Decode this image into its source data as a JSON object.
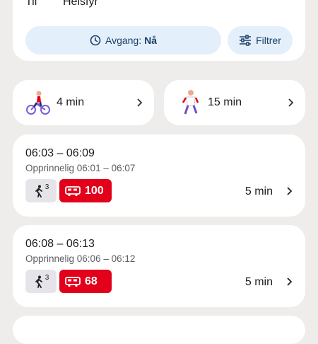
{
  "search": {
    "to_label": "Til",
    "to_value": "Helsfyr",
    "departure_label": "Avgang:",
    "departure_value": "Nå",
    "filter_label": "Filtrer"
  },
  "modes": [
    {
      "label": "4 min",
      "icon": "bike-illustration-icon"
    },
    {
      "label": "15 min",
      "icon": "walk-illustration-icon"
    }
  ],
  "trips": [
    {
      "time": "06:03 – 06:09",
      "original": "Opprinnelig 06:01 – 06:07",
      "walk_minutes": "3",
      "bus_line": "100",
      "duration": "5 min"
    },
    {
      "time": "06:08 – 06:13",
      "original": "Opprinnelig 06:06 – 06:12",
      "walk_minutes": "3",
      "bus_line": "68",
      "duration": "5 min"
    }
  ],
  "colors": {
    "bus": "#e2001a",
    "pill": "#e3f0fb",
    "background": "#efedeb"
  }
}
